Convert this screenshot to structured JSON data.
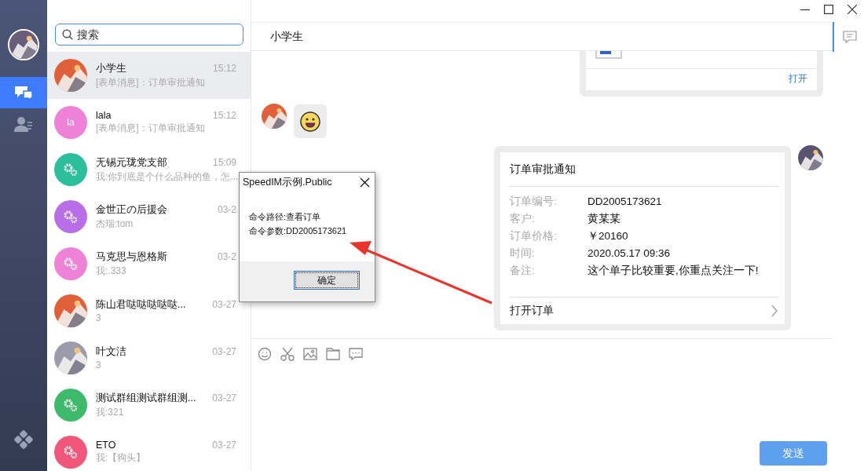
{
  "nav": {
    "items": [
      {
        "kind": "chat",
        "selected": true
      },
      {
        "kind": "contacts",
        "selected": false
      }
    ]
  },
  "search": {
    "placeholder": "搜索"
  },
  "conversations": [
    {
      "name": "小学生",
      "preview": "[表单消息]：订单审批通知",
      "time": "15:12",
      "selected": true
    },
    {
      "name": "lala",
      "preview": "[表单消息]：订单审批通知",
      "time": "15:12",
      "selected": false,
      "avatar": {
        "kind": "initials",
        "text": "la",
        "color": "#ee82d8"
      }
    },
    {
      "name": "无锡元珑党支部",
      "preview": "我:你到底是个什么品种的鱼，怎...",
      "time": "15:09",
      "selected": false,
      "avatar": {
        "kind": "group",
        "color": "#2cbf9c"
      }
    },
    {
      "name": "金世正の后援会",
      "preview": "杰瑞:tom",
      "time": "03-2",
      "selected": false,
      "avatar": {
        "kind": "group",
        "color": "#b86ee6"
      }
    },
    {
      "name": "马克思与恩格斯",
      "preview": "我:.333",
      "time": "03-2",
      "selected": false,
      "avatar": {
        "kind": "group",
        "color": "#ee82d8"
      }
    },
    {
      "name": "陈山君哒哒哒哒哒...",
      "preview": "3",
      "time": "03-27",
      "selected": false
    },
    {
      "name": "叶文洁",
      "preview": "3",
      "time": "03-27",
      "selected": false
    },
    {
      "name": "测试群组测试群组测...",
      "preview": "我:321",
      "time": "03-27",
      "selected": false,
      "avatar": {
        "kind": "group",
        "color": "#3dbb6a"
      }
    },
    {
      "name": "ETO",
      "preview": "我:【狗头】",
      "time": "03-27",
      "selected": false,
      "avatar": {
        "kind": "group",
        "color": "#f2567a"
      }
    }
  ],
  "chat": {
    "title": "小学生",
    "messages": [
      {
        "kind": "file",
        "outgoing": true,
        "action": "打开"
      },
      {
        "kind": "emoji",
        "outgoing": false
      },
      {
        "kind": "order",
        "outgoing": true,
        "title": "订单审批通知",
        "fields": [
          {
            "label": "订单编号:",
            "value": "DD2005173621"
          },
          {
            "label": "客户:",
            "value": "黄某某"
          },
          {
            "label": "订单价格:",
            "value": "￥20160"
          },
          {
            "label": "时间:",
            "value": "2020.05.17 09:36"
          },
          {
            "label": "备注:",
            "value": "这个单子比较重要,你重点关注一下!"
          }
        ],
        "action": "打开订单"
      }
    ]
  },
  "composer": {
    "send_button": "发送"
  },
  "dialog": {
    "title": "SpeedIM示例.Public",
    "lines": [
      "命令路径:查看订单",
      "命令参数:DD2005173621"
    ],
    "button": "确定"
  }
}
